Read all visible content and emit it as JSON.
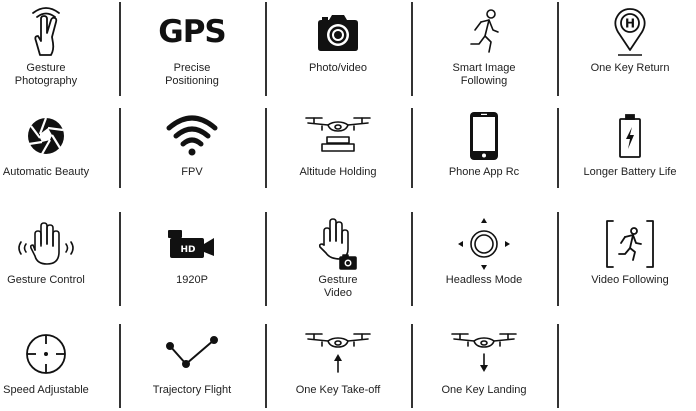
{
  "features": [
    {
      "icon": "gesture-hand-icon",
      "label": "Gesture\nPhotography"
    },
    {
      "icon": "gps-text-icon",
      "icon_text": "GPS",
      "label": "Precise\nPositioning"
    },
    {
      "icon": "camera-icon",
      "label": "Photo/video"
    },
    {
      "icon": "running-person-icon",
      "label": "Smart Image\nFollowing"
    },
    {
      "icon": "home-pin-icon",
      "icon_text": "H",
      "label": "One Key Return"
    },
    {
      "icon": "aperture-icon",
      "label": "Automatic Beauty"
    },
    {
      "icon": "wifi-icon",
      "label": "FPV"
    },
    {
      "icon": "drone-altitude-icon",
      "label": "Altitude Holding"
    },
    {
      "icon": "smartphone-icon",
      "label": "Phone App Rc"
    },
    {
      "icon": "battery-icon",
      "label": "Longer Battery Life"
    },
    {
      "icon": "waving-hand-icon",
      "label": "Gesture Control"
    },
    {
      "icon": "video-camera-icon",
      "icon_text": "HD",
      "label": "1920P"
    },
    {
      "icon": "hand-camera-icon",
      "label": "Gesture\nVideo"
    },
    {
      "icon": "headless-joystick-icon",
      "label": "Headless Mode"
    },
    {
      "icon": "video-follow-icon",
      "label": "Video Following"
    },
    {
      "icon": "speed-crosshair-icon",
      "label": "Speed Adjustable"
    },
    {
      "icon": "trajectory-icon",
      "label": "Trajectory Flight"
    },
    {
      "icon": "drone-takeoff-icon",
      "label": "One Key Take-off"
    },
    {
      "icon": "drone-landing-icon",
      "label": "One Key Landing"
    }
  ]
}
